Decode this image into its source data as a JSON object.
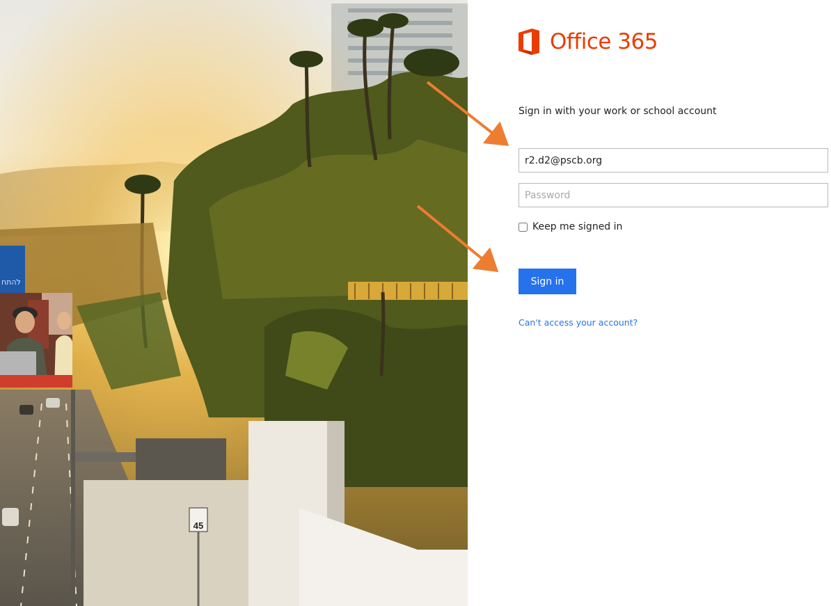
{
  "brand": {
    "name": "Office 365",
    "logo_color": "#eb3c00",
    "logo_icon": "office-logo-icon"
  },
  "signin": {
    "heading": "Sign in with your work or school account",
    "email_value": "r2.d2@pscb.org",
    "password_placeholder": "Password",
    "keep_signed_in_label": "Keep me signed in",
    "keep_signed_in_checked": false,
    "signin_button": "Sign in",
    "cant_access_link": "Can't access your account?",
    "accent_color": "#2672ec"
  },
  "promo": {
    "tile_text": "להתח"
  },
  "annotations": {
    "arrow_color": "#ed7d31",
    "arrows": [
      "arrow-to-email-field",
      "arrow-to-signin-button"
    ]
  }
}
